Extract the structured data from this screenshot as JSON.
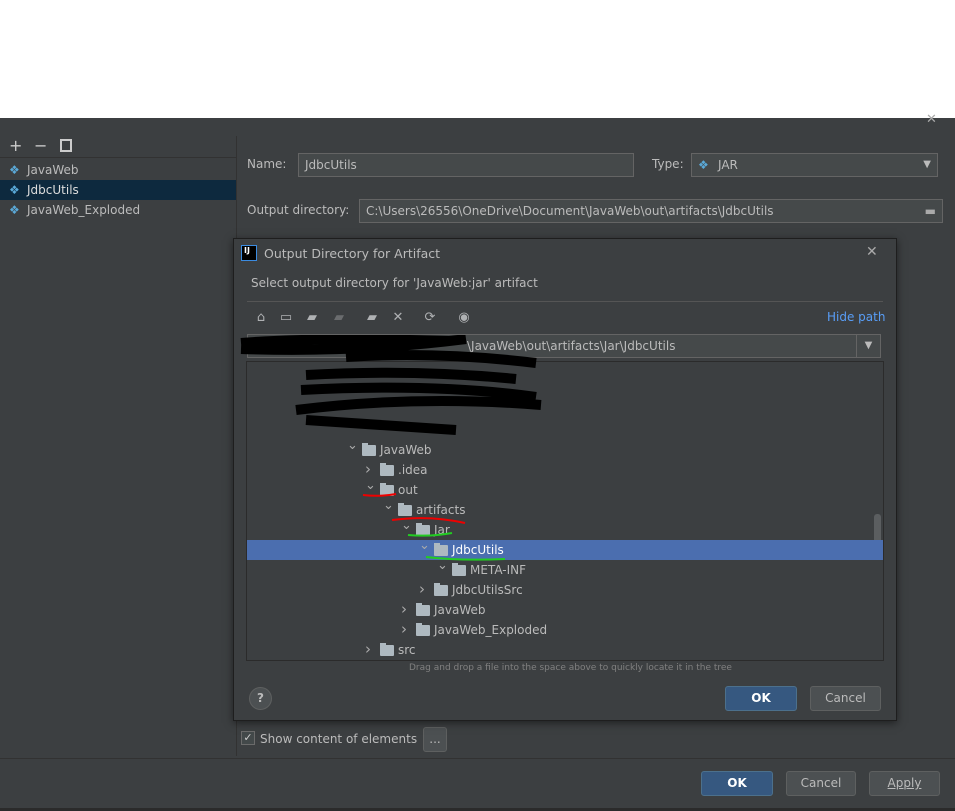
{
  "left_panel": {
    "toolbar": [
      "add-icon",
      "remove-icon",
      "copy-icon"
    ],
    "items": [
      {
        "label": "JavaWeb",
        "selected": false
      },
      {
        "label": "JdbcUtils",
        "selected": true
      },
      {
        "label": "JavaWeb_Exploded",
        "selected": false
      }
    ]
  },
  "form": {
    "name_label": "Name:",
    "name_value": "JdbcUtils",
    "type_label": "Type:",
    "type_value": "JAR",
    "output_label": "Output directory:",
    "output_value": "C:\\Users\\26556\\OneDrive\\Document\\JavaWeb\\out\\artifacts\\JdbcUtils",
    "show_content_label": "Show content of elements",
    "show_content_checked": true,
    "more_button": "..."
  },
  "dialog": {
    "title": "Output Directory for Artifact",
    "subtitle": "Select output directory for 'JavaWeb:jar' artifact",
    "hide_path": "Hide path",
    "path_value": "\\JavaWeb\\out\\artifacts\\Jar\\JdbcUtils",
    "hint": "Drag and drop a file into the space above to quickly locate it in the tree",
    "ok": "OK",
    "cancel": "Cancel",
    "help": "?",
    "tree": [
      {
        "label": "JavaWeb",
        "level": 0,
        "expanded": true
      },
      {
        "label": ".idea",
        "level": 1,
        "expanded": false
      },
      {
        "label": "out",
        "level": 1,
        "expanded": true
      },
      {
        "label": "artifacts",
        "level": 2,
        "expanded": true
      },
      {
        "label": "Jar",
        "level": 3,
        "expanded": true
      },
      {
        "label": "JdbcUtils",
        "level": 4,
        "expanded": true,
        "selected": true
      },
      {
        "label": "META-INF",
        "level": 5,
        "expanded": true
      },
      {
        "label": "JdbcUtilsSrc",
        "level": 4,
        "expanded": false
      },
      {
        "label": "JavaWeb",
        "level": 3,
        "expanded": false
      },
      {
        "label": "JavaWeb_Exploded",
        "level": 3,
        "expanded": false
      },
      {
        "label": "src",
        "level": 1,
        "expanded": false
      }
    ]
  },
  "footer": {
    "ok": "OK",
    "cancel": "Cancel",
    "apply": "Apply"
  },
  "colors": {
    "accent": "#365880",
    "selection": "#4b6eaf",
    "link": "#589df6"
  }
}
